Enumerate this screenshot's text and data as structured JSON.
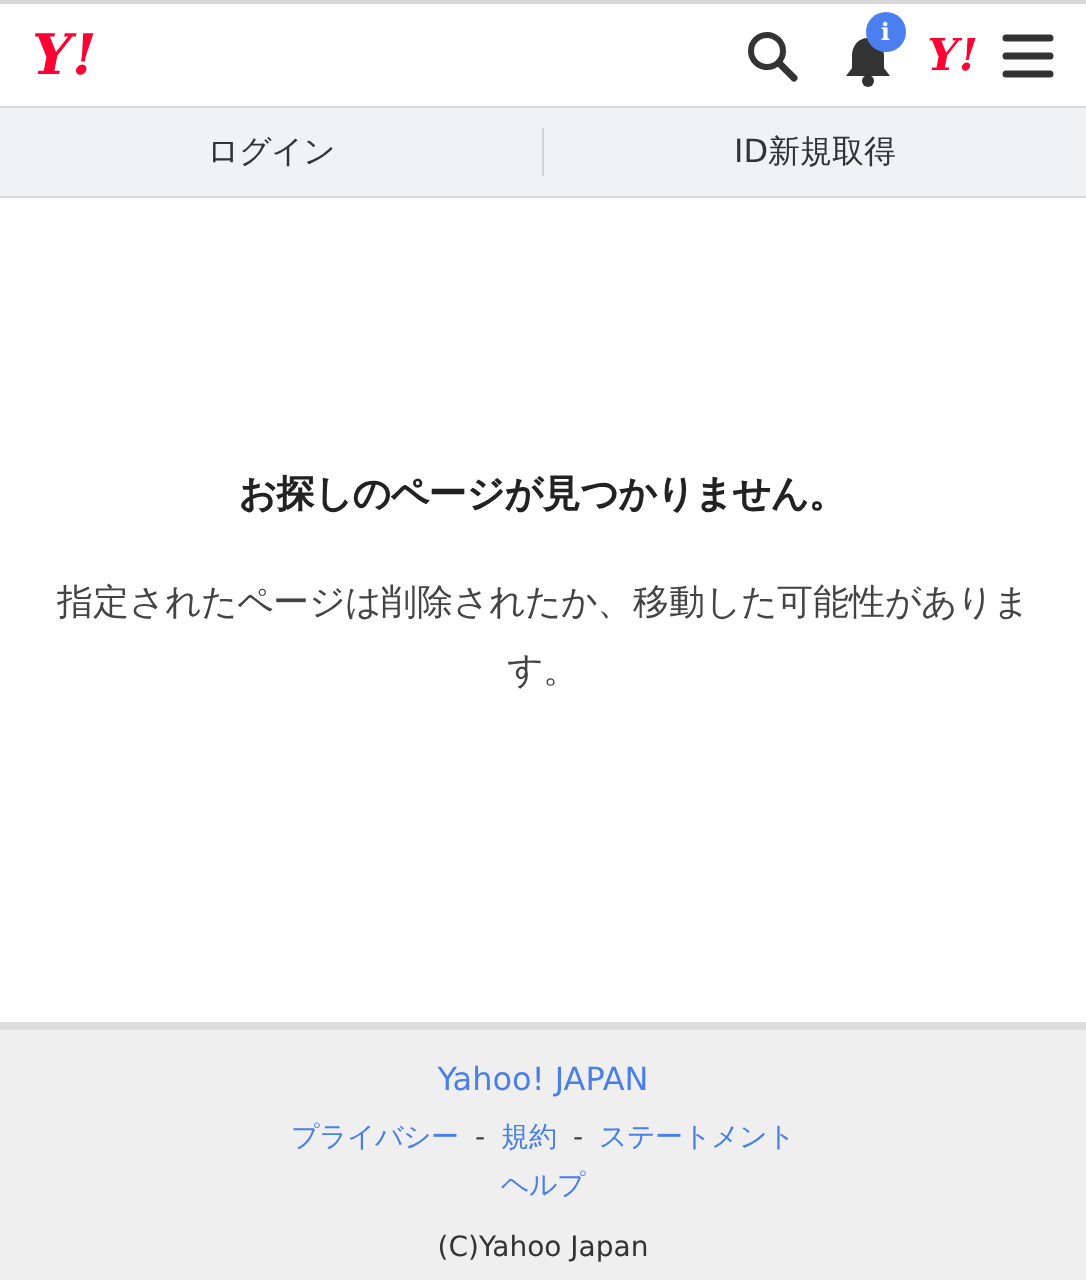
{
  "header": {
    "logo": "Y!",
    "notification_badge": "i",
    "account_logo": "Y!"
  },
  "nav": [
    {
      "label": "ログイン"
    },
    {
      "label": "ID新規取得"
    }
  ],
  "message": {
    "title": "お探しのページが見つかりません。",
    "body": "指定されたページは削除されたか、移動した可能性があります。"
  },
  "footer": {
    "brand_link": "Yahoo! JAPAN",
    "links": [
      {
        "kind": "link",
        "text": "プライバシー"
      },
      {
        "kind": "separator",
        "text": "-"
      },
      {
        "kind": "link",
        "text": "規約"
      },
      {
        "kind": "separator",
        "text": "-"
      },
      {
        "kind": "link",
        "text": "ステートメント"
      }
    ],
    "help_link": "ヘルプ",
    "copyright": "(C)Yahoo Japan"
  }
}
